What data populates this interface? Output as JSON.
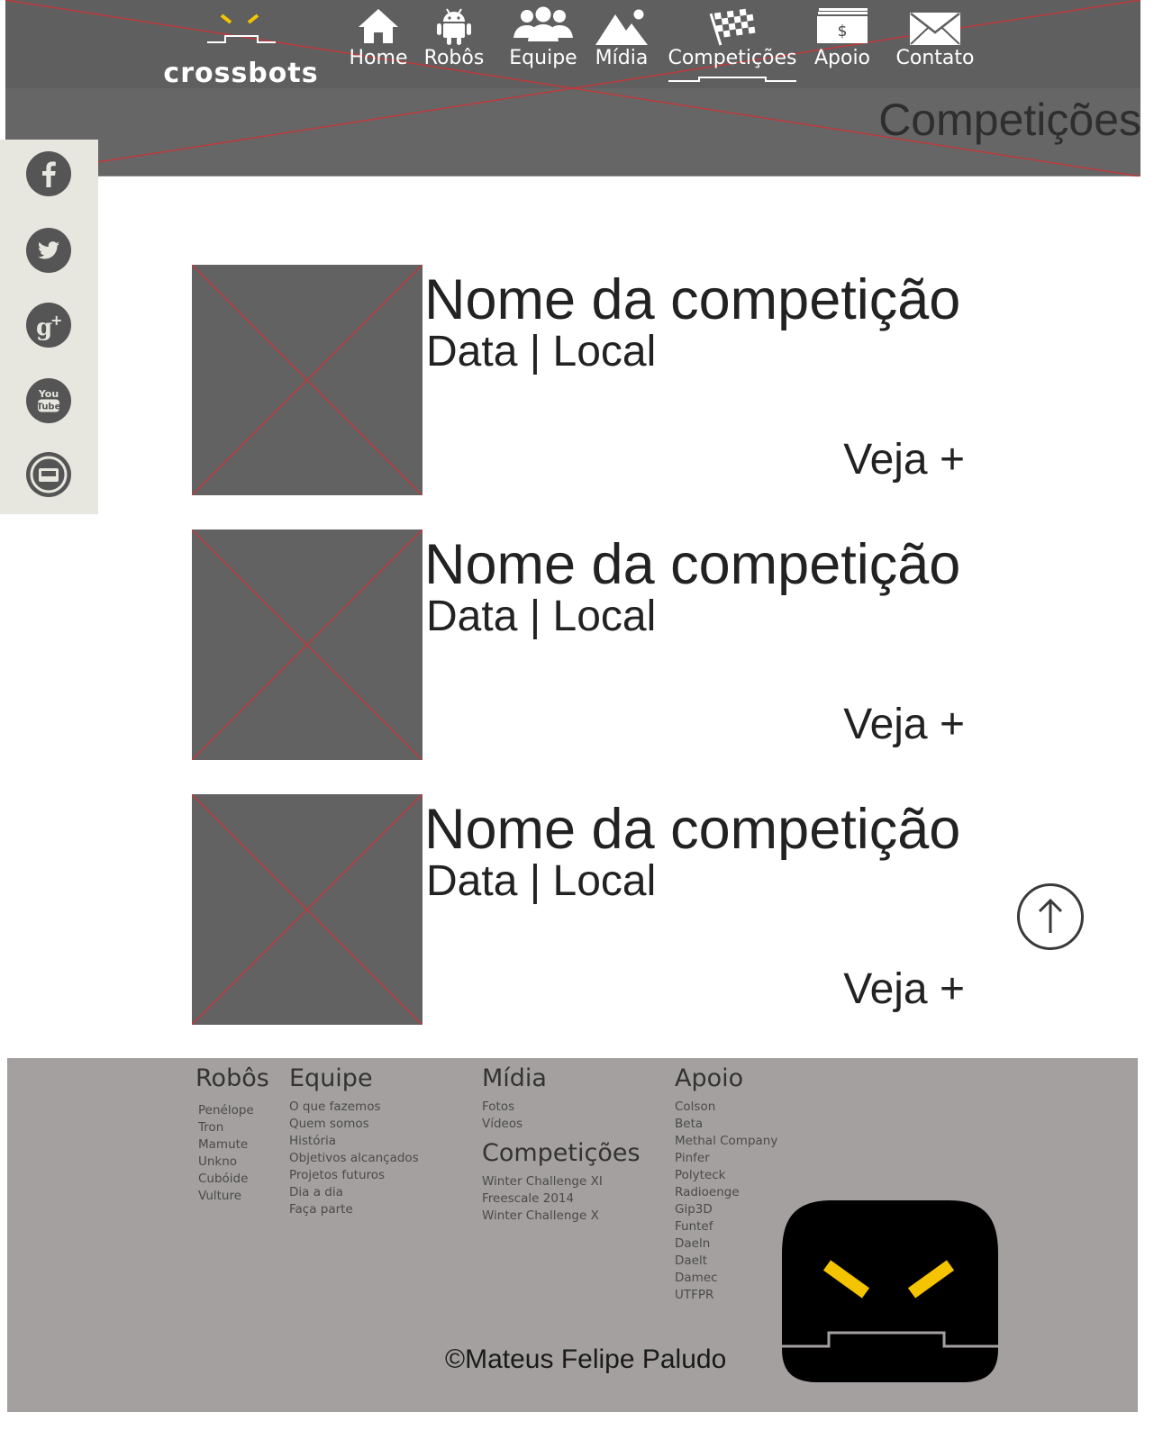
{
  "brand": {
    "name": "crossbots",
    "accent_color": "#f5c400"
  },
  "nav": {
    "items": [
      {
        "label": "Home",
        "icon": "home-icon"
      },
      {
        "label": "Robôs",
        "icon": "android-robot-icon"
      },
      {
        "label": "Equipe",
        "icon": "group-icon"
      },
      {
        "label": "Mídia",
        "icon": "mountain-image-icon"
      },
      {
        "label": "Competições",
        "icon": "checkered-flag-icon",
        "active": true
      },
      {
        "label": "Apoio",
        "icon": "money-icon",
        "icon_text": "$"
      },
      {
        "label": "Contato",
        "icon": "envelope-icon"
      }
    ]
  },
  "page": {
    "heading": "Competições"
  },
  "social": [
    {
      "name": "facebook-icon"
    },
    {
      "name": "twitter-icon"
    },
    {
      "name": "google-plus-icon"
    },
    {
      "name": "youtube-icon",
      "text_top": "You",
      "text_bottom": "Tube"
    },
    {
      "name": "email-icon"
    }
  ],
  "competitions": [
    {
      "name": "Nome da competição",
      "meta": "Data | Local",
      "more": "Veja +"
    },
    {
      "name": "Nome da competição",
      "meta": "Data | Local",
      "more": "Veja +"
    },
    {
      "name": "Nome da competição",
      "meta": "Data | Local",
      "more": "Veja +"
    }
  ],
  "footer": {
    "robots": {
      "heading": "Robôs",
      "items": [
        "Penélope",
        "Tron",
        "Mamute",
        "Unkno",
        "Cubóide",
        "Vulture"
      ]
    },
    "team": {
      "heading": "Equipe",
      "items": [
        "O que fazemos",
        "Quem somos",
        "História",
        "Objetivos alcançados",
        "Projetos futuros",
        "Dia a dia",
        "Faça parte"
      ]
    },
    "media": {
      "heading": "Mídia",
      "items": [
        "Fotos",
        "Vídeos"
      ]
    },
    "competitions": {
      "heading": "Competições",
      "items": [
        "Winter Challenge XI",
        "Freescale 2014",
        "Winter Challenge X"
      ]
    },
    "support": {
      "heading": "Apoio",
      "items": [
        "Colson",
        "Beta",
        "Methal Company",
        "Pinfer",
        "Polyteck",
        "Radioenge",
        "Gip3D",
        "Funtef",
        "Daeln",
        "Daelt",
        "Damec",
        "UTFPR"
      ]
    },
    "copyright": "©Mateus Felipe Paludo"
  }
}
